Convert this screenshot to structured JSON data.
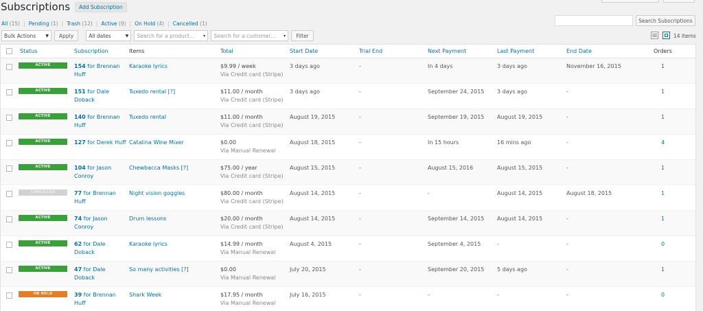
{
  "page": {
    "title": "Subscriptions",
    "add_label": "Add Subscription"
  },
  "filters": [
    {
      "label": "All",
      "count": "(15)"
    },
    {
      "label": "Pending",
      "count": "(1)"
    },
    {
      "label": "Trash",
      "count": "(12)"
    },
    {
      "label": "Active",
      "count": "(9)"
    },
    {
      "label": "On Hold",
      "count": "(4)"
    },
    {
      "label": "Cancelled",
      "count": "(1)"
    }
  ],
  "search": {
    "button": "Search Subscriptions",
    "value": ""
  },
  "toolbar": {
    "bulk_actions": "Bulk Actions",
    "apply": "Apply",
    "dates": "All dates",
    "product_placeholder": "Search for a product…",
    "customer_placeholder": "Search for a customer…",
    "filter": "Filter",
    "items_count": "14 items"
  },
  "columns": {
    "status": "Status",
    "subscription": "Subscription",
    "items": "Items",
    "total": "Total",
    "start_date": "Start Date",
    "trial_end": "Trial End",
    "next_payment": "Next Payment",
    "last_payment": "Last Payment",
    "end_date": "End Date",
    "orders": "Orders"
  },
  "rows": [
    {
      "status": "ACTIVE",
      "status_key": "active",
      "sub_id": "154",
      "sub_for": " for Brennan Huff",
      "item": "Karaoke lyrics",
      "amount": "$9.99 / week",
      "via": "Via Credit card (Stripe)",
      "start": "3 days ago",
      "trial": "-",
      "next": "In 4 days",
      "last": "3 days ago",
      "end": "November 16, 2015",
      "orders": "1"
    },
    {
      "status": "ACTIVE",
      "status_key": "active",
      "sub_id": "151",
      "sub_for": " for Dale Doback",
      "item": "Tuxedo rental [?]",
      "amount": "$11.00 / month",
      "via": "Via Credit card (Stripe)",
      "start": "3 days ago",
      "trial": "-",
      "next": "September 24, 2015",
      "last": "3 days ago",
      "end": "-",
      "orders": "1"
    },
    {
      "status": "ACTIVE",
      "status_key": "active",
      "sub_id": "140",
      "sub_for": " for Brennan Huff",
      "item": "Tuxedo rental",
      "amount": "$11.00 / month",
      "via": "Via Credit card (Stripe)",
      "start": "August 19, 2015",
      "trial": "-",
      "next": "September 19, 2015",
      "last": "August 19, 2015",
      "end": "-",
      "orders": "1"
    },
    {
      "status": "ACTIVE",
      "status_key": "active",
      "sub_id": "127",
      "sub_for": " for Derek Huff",
      "item": "Catalina Wine Mixer",
      "amount": "$0.00",
      "via": "Via Manual Renewal",
      "start": "August 18, 2015",
      "trial": "-",
      "next": "In 15 hours",
      "last": "16 mins ago",
      "end": "-",
      "orders": "4"
    },
    {
      "status": "ACTIVE",
      "status_key": "active",
      "sub_id": "104",
      "sub_for": " for Jason Conroy",
      "item": "Chewbacca Masks [?]",
      "amount": "$75.00 / year",
      "via": "Via Credit card (Stripe)",
      "start": "August 15, 2015",
      "trial": "-",
      "next": "August 15, 2016",
      "last": "August 15, 2015",
      "end": "-",
      "orders": "1"
    },
    {
      "status": "CANCELLED",
      "status_key": "cancelled",
      "sub_id": "77",
      "sub_for": " for Brennan Huff",
      "item": "Night vision goggles",
      "amount": "$80.00 / month",
      "via": "Via Credit card (Stripe)",
      "start": "August 14, 2015",
      "trial": "-",
      "next": "-",
      "last": "August 14, 2015",
      "end": "August 18, 2015",
      "orders": "1"
    },
    {
      "status": "ACTIVE",
      "status_key": "active",
      "sub_id": "74",
      "sub_for": " for Jason Conroy",
      "item": "Drum lessons",
      "amount": "$20.00 / month",
      "via": "Via Credit card (Stripe)",
      "start": "August 14, 2015",
      "trial": "-",
      "next": "September 14, 2015",
      "last": "August 14, 2015",
      "end": "-",
      "orders": "1"
    },
    {
      "status": "ACTIVE",
      "status_key": "active",
      "sub_id": "62",
      "sub_for": " for Dale Doback",
      "item": "Karaoke lyrics",
      "amount": "$14.99 / month",
      "via": "Via Manual Renewal",
      "start": "August 4, 2015",
      "trial": "-",
      "next": "September 4, 2015",
      "last": "-",
      "end": "-",
      "orders": "0"
    },
    {
      "status": "ACTIVE",
      "status_key": "active",
      "sub_id": "47",
      "sub_for": " for Dale Doback",
      "item": "So many activities [?]",
      "amount": "$0.00",
      "via": "Via Manual Renewal",
      "start": "July 20, 2015",
      "trial": "-",
      "next": "September 20, 2015",
      "last": "5 days ago",
      "end": "-",
      "orders": "1"
    },
    {
      "status": "ON HOLD",
      "status_key": "on-hold",
      "sub_id": "39",
      "sub_for": " for Brennan Huff",
      "item": "Shark Week",
      "amount": "$17.95 / month",
      "via": "Via Manual Renewal",
      "start": "July 16, 2015",
      "trial": "-",
      "next": "-",
      "last": "-",
      "end": "-",
      "orders": "0"
    }
  ]
}
